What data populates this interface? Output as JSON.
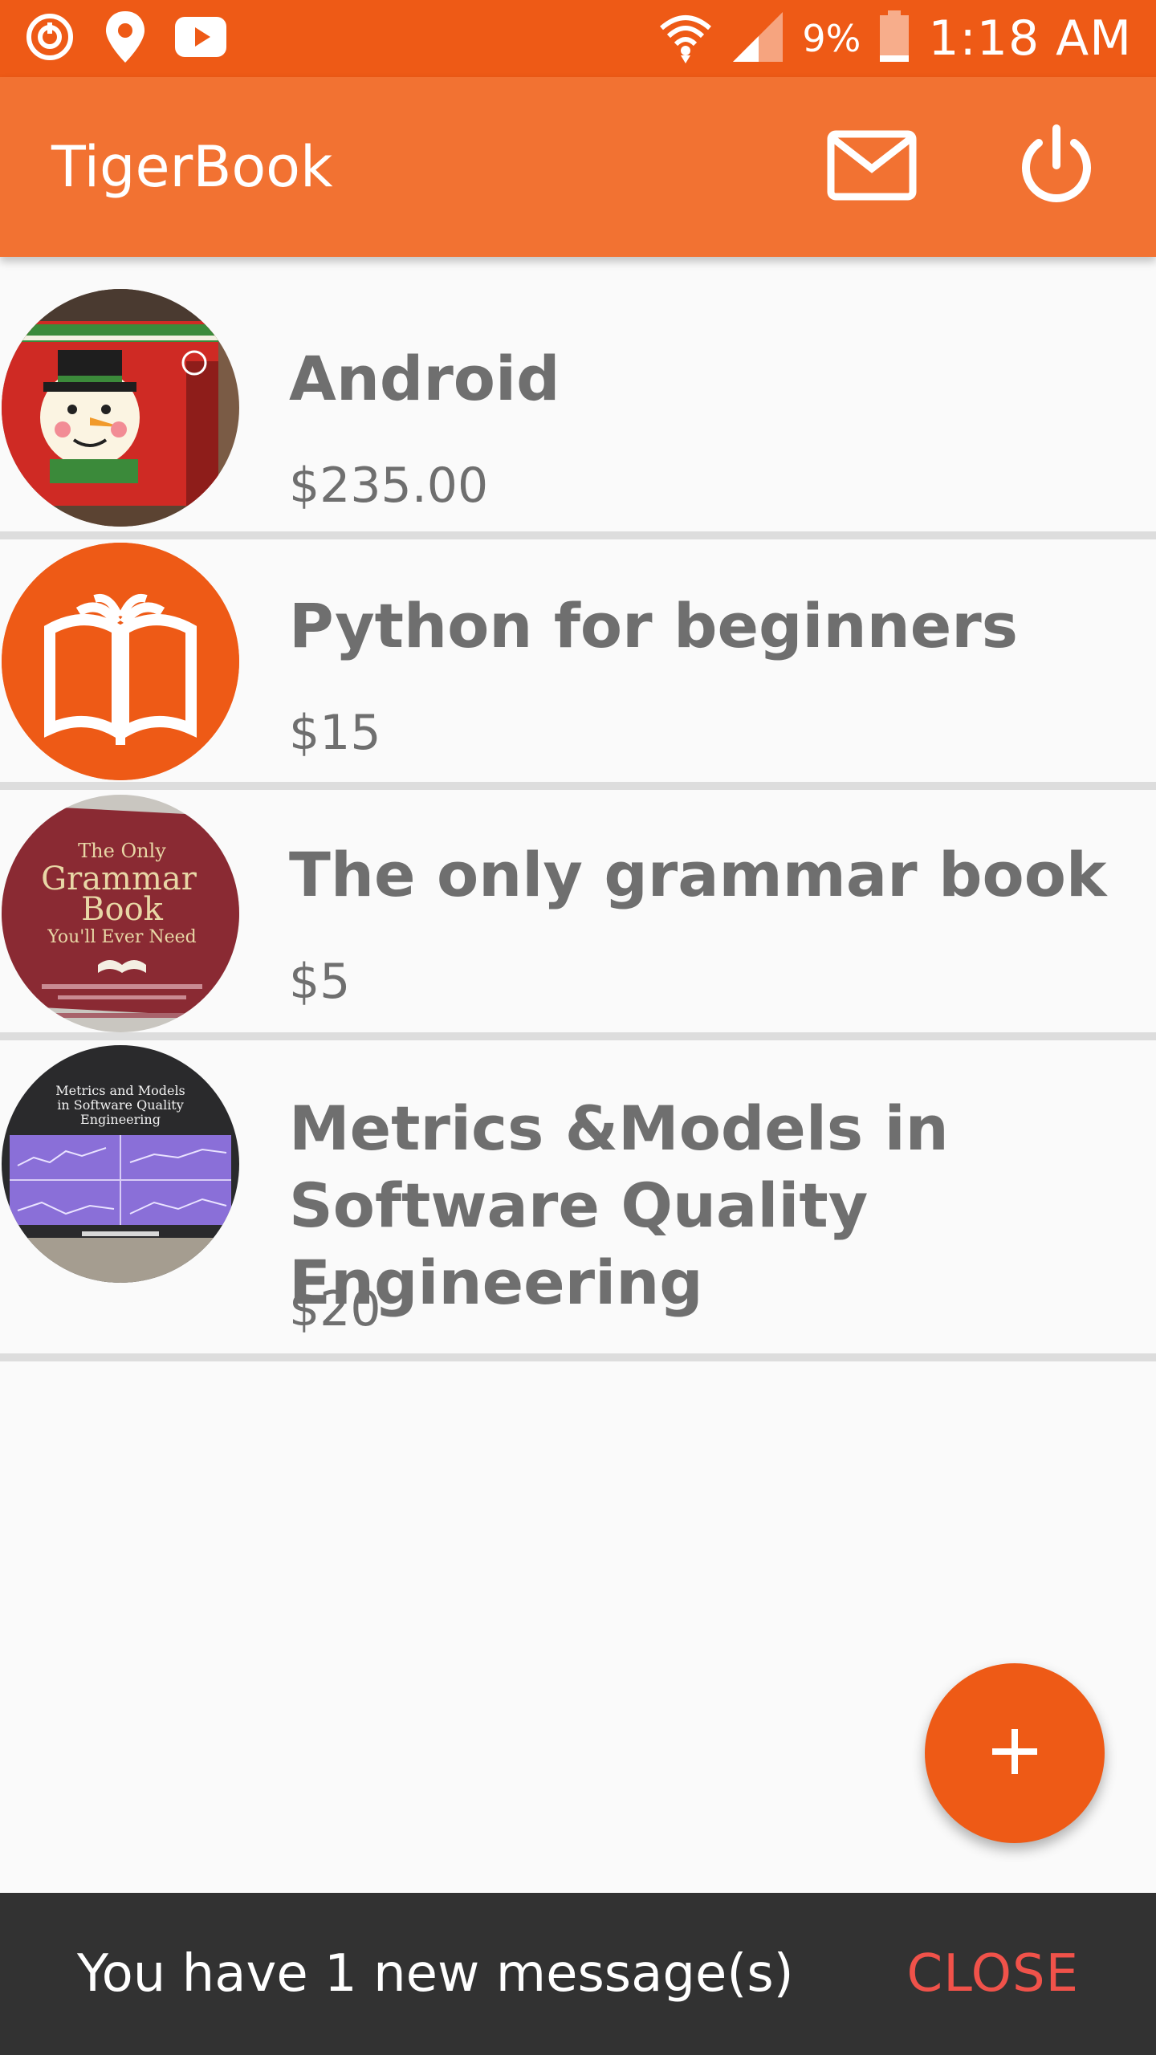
{
  "status_bar": {
    "battery_percent": "9%",
    "time": "1:18 AM",
    "left_icons": [
      "sync-icon",
      "location-pin-icon",
      "youtube-icon"
    ],
    "right_icons": [
      "wifi-icon",
      "signal-icon",
      "battery-icon"
    ]
  },
  "app_bar": {
    "title": "TigerBook",
    "actions": [
      "mail-icon",
      "power-icon"
    ]
  },
  "books": [
    {
      "title": "Android",
      "price": "$235.00",
      "thumb": "snowman-mug-image"
    },
    {
      "title": "Python for beginners",
      "price": "$15",
      "thumb": "open-book-icon"
    },
    {
      "title": "The only grammar book",
      "price": "$5",
      "thumb": "grammar-book-cover-image"
    },
    {
      "title": "Metrics &Models in Software Quality Engineering",
      "price": "$20",
      "thumb": "metrics-book-cover-image"
    }
  ],
  "grammar_cover": {
    "line1": "The Only",
    "line2": "Grammar",
    "line3": "Book",
    "line4": "You'll Ever Need"
  },
  "metrics_cover": {
    "line1": "Metrics and Models",
    "line2": "in Software Quality",
    "line3": "Engineering"
  },
  "fab": {
    "icon": "plus-icon"
  },
  "snackbar": {
    "message": "You have 1 new message(s)",
    "action": "CLOSE"
  },
  "colors": {
    "status_bar": "#ee5a16",
    "app_bar": "#f27232",
    "accent": "#ee5a16",
    "snackbar_action": "#f0524a"
  }
}
